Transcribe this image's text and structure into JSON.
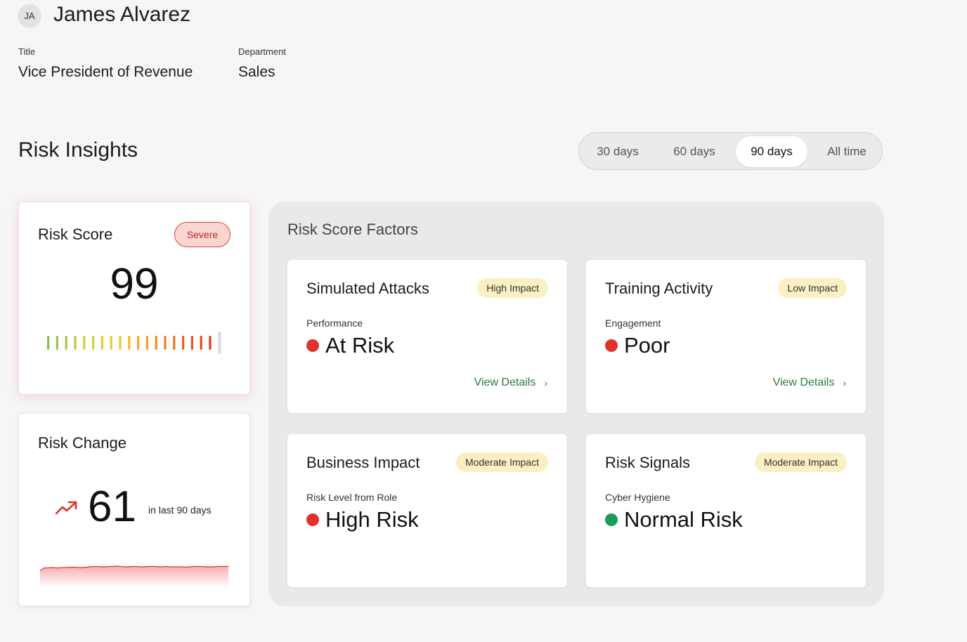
{
  "user": {
    "initials": "JA",
    "name": "James Alvarez",
    "title_label": "Title",
    "title_value": "Vice President of Revenue",
    "department_label": "Department",
    "department_value": "Sales"
  },
  "section_title": "Risk Insights",
  "range": {
    "options": [
      "30 days",
      "60 days",
      "90 days",
      "All time"
    ],
    "selected": "90 days"
  },
  "risk_score": {
    "title": "Risk Score",
    "severity": "Severe",
    "value": "99",
    "gauge_level": 0.99,
    "colors": {
      "badge_bg": "#fbd5d0",
      "badge_border": "#d9473d",
      "badge_text": "#c0281f"
    }
  },
  "risk_change": {
    "title": "Risk Change",
    "value": "61",
    "suffix": "in last 90 days",
    "trend": "up",
    "trend_icon": "trending-up-icon",
    "sparkline_values": [
      38,
      47,
      47,
      48,
      47,
      47,
      48,
      48,
      49,
      49,
      48,
      48,
      49,
      50,
      51,
      51,
      50,
      50,
      51,
      51,
      52,
      51,
      50,
      50,
      51,
      51,
      50,
      50,
      51,
      51,
      51,
      50,
      50,
      51,
      50,
      50,
      50,
      50,
      49,
      50,
      51,
      51,
      51,
      50,
      50,
      50,
      51,
      51,
      51,
      52
    ]
  },
  "factors": {
    "title": "Risk Score Factors",
    "view_details_label": "View Details",
    "colors": {
      "risk": "#e0312b",
      "normal": "#1a9c5b",
      "impact_bg": "#fbefc3",
      "link": "#2f7a3a"
    },
    "items": [
      {
        "title": "Simulated Attacks",
        "impact": "High Impact",
        "metric": "Performance",
        "status": "At Risk",
        "status_level": "risk",
        "has_details": true
      },
      {
        "title": "Training Activity",
        "impact": "Low Impact",
        "metric": "Engagement",
        "status": "Poor",
        "status_level": "risk",
        "has_details": true
      },
      {
        "title": "Business Impact",
        "impact": "Moderate Impact",
        "metric": "Risk Level from Role",
        "status": "High Risk",
        "status_level": "risk",
        "has_details": false
      },
      {
        "title": "Risk Signals",
        "impact": "Moderate Impact",
        "metric": "Cyber Hygiene",
        "status": "Normal Risk",
        "status_level": "normal",
        "has_details": false
      }
    ]
  }
}
